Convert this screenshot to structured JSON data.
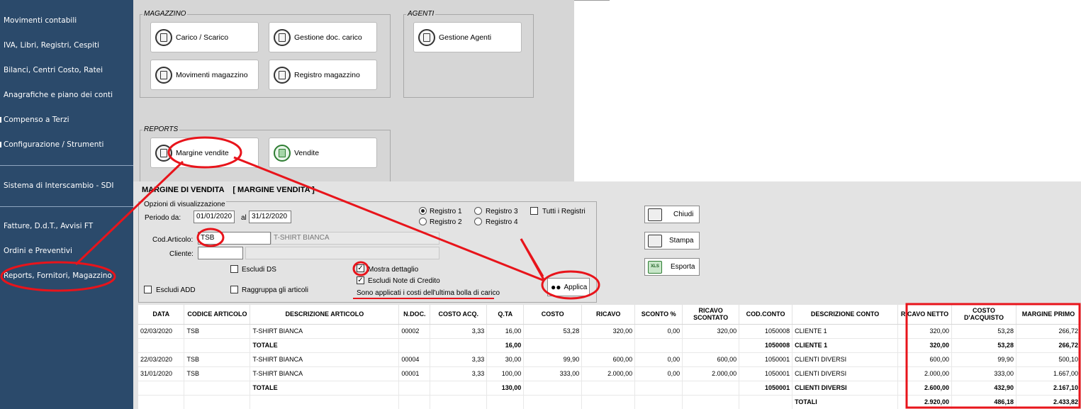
{
  "sidebar": {
    "items": [
      {
        "label": "Movimenti contabili"
      },
      {
        "label": "IVA, Libri, Registri, Cespiti"
      },
      {
        "label": "Bilanci, Centri Costo, Ratei"
      },
      {
        "label": "Anagrafiche e piano dei conti"
      },
      {
        "label": "Compenso a Terzi"
      },
      {
        "label": "Configurazione / Strumenti"
      },
      {
        "label": "Sistema di Interscambio - SDI"
      },
      {
        "label": "Fatture, D.d.T., Avvisi FT"
      },
      {
        "label": "Ordini e Preventivi"
      },
      {
        "label": "Reports, Fornitori, Magazzino"
      }
    ]
  },
  "groups": {
    "magazzino": {
      "title": "MAGAZZINO",
      "tiles": [
        "Carico / Scarico",
        "Gestione doc. carico",
        "Movimenti magazzino",
        "Registro magazzino"
      ]
    },
    "agenti": {
      "title": "AGENTI",
      "tiles": [
        "Gestione Agenti"
      ]
    },
    "reports": {
      "title": "REPORTS",
      "tiles": [
        "Margine vendite",
        "Vendite"
      ]
    }
  },
  "report": {
    "title": "MARGINE DI VENDITA    [ MARGINE VENDITA ]",
    "options_title": "Opzioni di visualizzazione",
    "periodo_label": "Periodo da:",
    "date_from": "01/01/2020",
    "al_label": "al",
    "date_to": "31/12/2020",
    "articolo_label": "Cod.Articolo:",
    "articolo_code": "TSB",
    "articolo_desc": "T-SHIRT BIANCA",
    "cliente_label": "Cliente:",
    "cliente_code": "",
    "cliente_desc": "",
    "radios": [
      "Registro 1",
      "Registro 2",
      "Registro 3",
      "Registro 4"
    ],
    "tutti_registri": "Tutti i Registri",
    "escludi_ds": "Escludi DS",
    "escludi_add": "Escludi ADD",
    "raggruppa": "Raggruppa gli articoli",
    "mostra_dettaglio": "Mostra dettaglio",
    "escludi_note": "Escludi Note di Credito",
    "note_costi": "Sono applicati i costi dell'ultima bolla di carico",
    "applica": "Applica",
    "chiudi": "Chiudi",
    "stampa": "Stampa",
    "esporta": "Esporta",
    "xls_icon_text": "XLS"
  },
  "table": {
    "columns": [
      "DATA",
      "CODICE ARTICOLO",
      "DESCRIZIONE ARTICOLO",
      "N.DOC.",
      "COSTO ACQ.",
      "Q.TA",
      "COSTO",
      "RICAVO",
      "SCONTO %",
      "RICAVO SCONTATO",
      "COD.CONTO",
      "DESCRIZIONE CONTO",
      "RICAVO NETTO",
      "COSTO D'ACQUISTO",
      "MARGINE PRIMO"
    ],
    "rows": [
      {
        "total": false,
        "cells": [
          "02/03/2020",
          "TSB",
          "T-SHIRT BIANCA",
          "00002",
          "3,33",
          "16,00",
          "53,28",
          "320,00",
          "0,00",
          "320,00",
          "1050008",
          "CLIENTE 1",
          "320,00",
          "53,28",
          "266,72"
        ]
      },
      {
        "total": true,
        "cells": [
          "",
          "",
          "TOTALE",
          "",
          "",
          "16,00",
          "",
          "",
          "",
          "",
          "1050008",
          "CLIENTE 1",
          "320,00",
          "53,28",
          "266,72"
        ]
      },
      {
        "total": false,
        "cells": [
          "22/03/2020",
          "TSB",
          "T-SHIRT BIANCA",
          "00004",
          "3,33",
          "30,00",
          "99,90",
          "600,00",
          "0,00",
          "600,00",
          "1050001",
          "CLIENTI DIVERSI",
          "600,00",
          "99,90",
          "500,10"
        ]
      },
      {
        "total": false,
        "cells": [
          "31/01/2020",
          "TSB",
          "T-SHIRT BIANCA",
          "00001",
          "3,33",
          "100,00",
          "333,00",
          "2.000,00",
          "0,00",
          "2.000,00",
          "1050001",
          "CLIENTI DIVERSI",
          "2.000,00",
          "333,00",
          "1.667,00"
        ]
      },
      {
        "total": true,
        "cells": [
          "",
          "",
          "TOTALE",
          "",
          "",
          "130,00",
          "",
          "",
          "",
          "",
          "1050001",
          "CLIENTI DIVERSI",
          "2.600,00",
          "432,90",
          "2.167,10"
        ]
      },
      {
        "total": true,
        "cells": [
          "",
          "",
          "",
          "",
          "",
          "",
          "",
          "",
          "",
          "",
          "",
          "TOTALI",
          "2.920,00",
          "486,18",
          "2.433,82"
        ]
      }
    ]
  },
  "colors": {
    "sidebar_bg": "#2b4a6b",
    "panel_bg": "#d6d6d6",
    "annotation": "#e8141b"
  }
}
